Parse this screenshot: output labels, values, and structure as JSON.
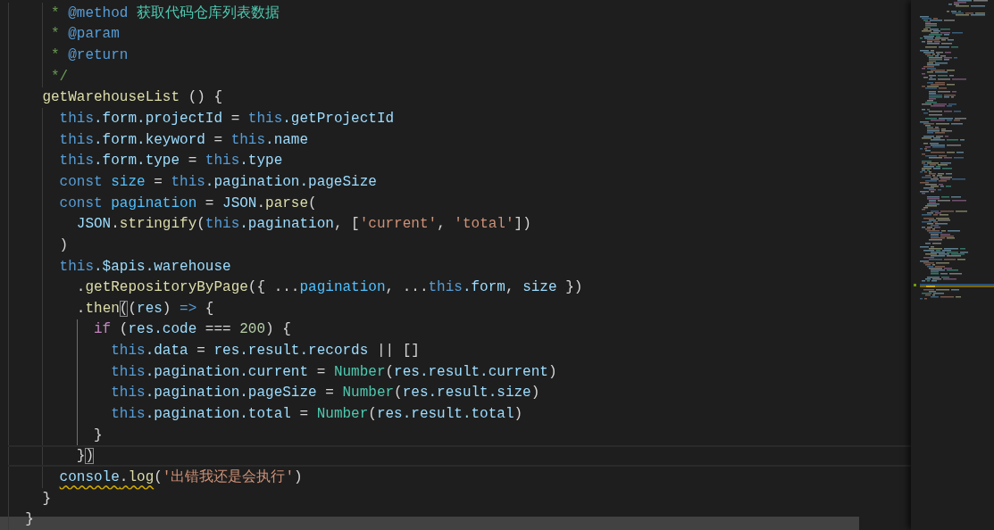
{
  "editor": {
    "lines": [
      {
        "current": false,
        "active_guide": false,
        "tokens": [
          {
            "text": "     * ",
            "kind": "comment"
          },
          {
            "text": "@method",
            "kind": "doc_tag"
          },
          {
            "text": " 获取代码仓库列表数据",
            "kind": "doc_text"
          }
        ]
      },
      {
        "current": false,
        "active_guide": false,
        "tokens": [
          {
            "text": "     * ",
            "kind": "comment"
          },
          {
            "text": "@param",
            "kind": "doc_tag"
          }
        ]
      },
      {
        "current": false,
        "active_guide": false,
        "tokens": [
          {
            "text": "     * ",
            "kind": "comment"
          },
          {
            "text": "@return",
            "kind": "doc_tag"
          }
        ]
      },
      {
        "current": false,
        "active_guide": false,
        "tokens": [
          {
            "text": "     */",
            "kind": "comment"
          }
        ]
      },
      {
        "current": false,
        "active_guide": false,
        "tokens": [
          {
            "text": "    getWarehouseList",
            "kind": "function"
          },
          {
            "text": " () {",
            "kind": "plain"
          }
        ]
      },
      {
        "current": false,
        "active_guide": false,
        "tokens": [
          {
            "text": "      this",
            "kind": "keyword"
          },
          {
            "text": ".form.projectId",
            "kind": "variable"
          },
          {
            "text": " = ",
            "kind": "plain"
          },
          {
            "text": "this",
            "kind": "keyword"
          },
          {
            "text": ".getProjectId",
            "kind": "variable"
          }
        ]
      },
      {
        "current": false,
        "active_guide": false,
        "tokens": [
          {
            "text": "      this",
            "kind": "keyword"
          },
          {
            "text": ".form.keyword",
            "kind": "variable"
          },
          {
            "text": " = ",
            "kind": "plain"
          },
          {
            "text": "this",
            "kind": "keyword"
          },
          {
            "text": ".name",
            "kind": "variable"
          }
        ]
      },
      {
        "current": false,
        "active_guide": false,
        "tokens": [
          {
            "text": "      this",
            "kind": "keyword"
          },
          {
            "text": ".form.type",
            "kind": "variable"
          },
          {
            "text": " = ",
            "kind": "plain"
          },
          {
            "text": "this",
            "kind": "keyword"
          },
          {
            "text": ".type",
            "kind": "variable"
          }
        ]
      },
      {
        "current": false,
        "active_guide": false,
        "tokens": [
          {
            "text": "      const ",
            "kind": "keyword"
          },
          {
            "text": "size",
            "kind": "constant"
          },
          {
            "text": " = ",
            "kind": "plain"
          },
          {
            "text": "this",
            "kind": "keyword"
          },
          {
            "text": ".pagination.pageSize",
            "kind": "variable"
          }
        ]
      },
      {
        "current": false,
        "active_guide": false,
        "tokens": [
          {
            "text": "      const ",
            "kind": "keyword"
          },
          {
            "text": "pagination",
            "kind": "constant"
          },
          {
            "text": " = ",
            "kind": "plain"
          },
          {
            "text": "JSON",
            "kind": "variable"
          },
          {
            "text": ".",
            "kind": "plain"
          },
          {
            "text": "parse",
            "kind": "function"
          },
          {
            "text": "(",
            "kind": "plain"
          }
        ]
      },
      {
        "current": false,
        "active_guide": false,
        "tokens": [
          {
            "text": "        JSON",
            "kind": "variable"
          },
          {
            "text": ".",
            "kind": "plain"
          },
          {
            "text": "stringify",
            "kind": "function"
          },
          {
            "text": "(",
            "kind": "plain"
          },
          {
            "text": "this",
            "kind": "keyword"
          },
          {
            "text": ".pagination",
            "kind": "variable"
          },
          {
            "text": ", [",
            "kind": "plain"
          },
          {
            "text": "'current'",
            "kind": "string"
          },
          {
            "text": ", ",
            "kind": "plain"
          },
          {
            "text": "'total'",
            "kind": "string"
          },
          {
            "text": "])",
            "kind": "plain"
          }
        ]
      },
      {
        "current": false,
        "active_guide": false,
        "tokens": [
          {
            "text": "      )",
            "kind": "plain"
          }
        ]
      },
      {
        "current": false,
        "active_guide": false,
        "tokens": [
          {
            "text": "      this",
            "kind": "keyword"
          },
          {
            "text": ".$apis.warehouse",
            "kind": "variable"
          }
        ]
      },
      {
        "current": false,
        "active_guide": false,
        "tokens": [
          {
            "text": "        .",
            "kind": "plain"
          },
          {
            "text": "getRepositoryByPage",
            "kind": "function"
          },
          {
            "text": "({ ...",
            "kind": "plain"
          },
          {
            "text": "pagination",
            "kind": "constant"
          },
          {
            "text": ", ...",
            "kind": "plain"
          },
          {
            "text": "this",
            "kind": "keyword"
          },
          {
            "text": ".form",
            "kind": "variable"
          },
          {
            "text": ", ",
            "kind": "plain"
          },
          {
            "text": "size",
            "kind": "variable"
          },
          {
            "text": " })",
            "kind": "plain"
          }
        ]
      },
      {
        "current": false,
        "active_guide": false,
        "tokens": [
          {
            "text": "        .",
            "kind": "plain"
          },
          {
            "text": "then",
            "kind": "function"
          },
          {
            "text": "(",
            "kind": "bracket_match"
          },
          {
            "text": "(",
            "kind": "plain"
          },
          {
            "text": "res",
            "kind": "variable"
          },
          {
            "text": ") ",
            "kind": "plain"
          },
          {
            "text": "=>",
            "kind": "keyword"
          },
          {
            "text": " {",
            "kind": "plain"
          }
        ]
      },
      {
        "current": false,
        "active_guide": true,
        "tokens": [
          {
            "text": "          if",
            "kind": "control"
          },
          {
            "text": " (",
            "kind": "plain"
          },
          {
            "text": "res.code",
            "kind": "variable"
          },
          {
            "text": " === ",
            "kind": "plain"
          },
          {
            "text": "200",
            "kind": "number"
          },
          {
            "text": ") {",
            "kind": "plain"
          }
        ]
      },
      {
        "current": false,
        "active_guide": true,
        "tokens": [
          {
            "text": "            this",
            "kind": "keyword"
          },
          {
            "text": ".data",
            "kind": "variable"
          },
          {
            "text": " = ",
            "kind": "plain"
          },
          {
            "text": "res.result.records",
            "kind": "variable"
          },
          {
            "text": " || []",
            "kind": "plain"
          }
        ]
      },
      {
        "current": false,
        "active_guide": true,
        "tokens": [
          {
            "text": "            this",
            "kind": "keyword"
          },
          {
            "text": ".pagination.current",
            "kind": "variable"
          },
          {
            "text": " = ",
            "kind": "plain"
          },
          {
            "text": "Number",
            "kind": "type"
          },
          {
            "text": "(",
            "kind": "plain"
          },
          {
            "text": "res.result.current",
            "kind": "variable"
          },
          {
            "text": ")",
            "kind": "plain"
          }
        ]
      },
      {
        "current": false,
        "active_guide": true,
        "tokens": [
          {
            "text": "            this",
            "kind": "keyword"
          },
          {
            "text": ".pagination.pageSize",
            "kind": "variable"
          },
          {
            "text": " = ",
            "kind": "plain"
          },
          {
            "text": "Number",
            "kind": "type"
          },
          {
            "text": "(",
            "kind": "plain"
          },
          {
            "text": "res.result.size",
            "kind": "variable"
          },
          {
            "text": ")",
            "kind": "plain"
          }
        ]
      },
      {
        "current": false,
        "active_guide": true,
        "tokens": [
          {
            "text": "            this",
            "kind": "keyword"
          },
          {
            "text": ".pagination.total",
            "kind": "variable"
          },
          {
            "text": " = ",
            "kind": "plain"
          },
          {
            "text": "Number",
            "kind": "type"
          },
          {
            "text": "(",
            "kind": "plain"
          },
          {
            "text": "res.result.total",
            "kind": "variable"
          },
          {
            "text": ")",
            "kind": "plain"
          }
        ]
      },
      {
        "current": false,
        "active_guide": true,
        "tokens": [
          {
            "text": "          }",
            "kind": "plain"
          }
        ]
      },
      {
        "current": true,
        "active_guide": false,
        "tokens": [
          {
            "text": "        }",
            "kind": "plain"
          },
          {
            "text": ")",
            "kind": "bracket_match"
          }
        ]
      },
      {
        "current": false,
        "active_guide": false,
        "tokens": [
          {
            "kind": "warning",
            "tokens": [
              {
                "text": "      console",
                "kind": "variable"
              },
              {
                "text": ".",
                "kind": "plain"
              },
              {
                "text": "log",
                "kind": "function"
              }
            ]
          },
          {
            "text": "(",
            "kind": "plain"
          },
          {
            "text": "'出错我还是会执行'",
            "kind": "string"
          },
          {
            "text": ")",
            "kind": "plain"
          }
        ]
      },
      {
        "current": false,
        "active_guide": false,
        "tokens": [
          {
            "text": "    }",
            "kind": "plain"
          }
        ]
      },
      {
        "current": false,
        "active_guide": false,
        "tokens": [
          {
            "text": "  }",
            "kind": "plain"
          }
        ]
      }
    ]
  }
}
